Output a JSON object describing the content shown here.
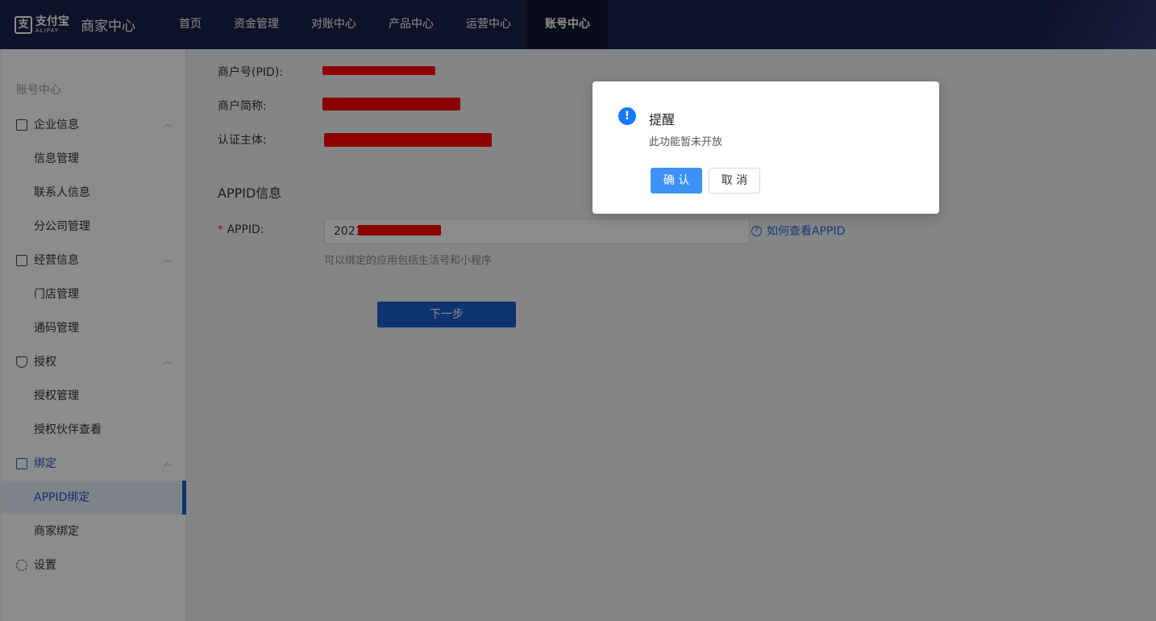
{
  "header": {
    "logo_cn": "支付宝",
    "logo_en": "ALIPAY",
    "title": "商家中心",
    "nav": [
      "首页",
      "资金管理",
      "对账中心",
      "产品中心",
      "运营中心",
      "账号中心"
    ],
    "active_nav": "账号中心",
    "bg_color": "#1b2149"
  },
  "sidebar": {
    "header": "账号中心",
    "groups": [
      {
        "label": "企业信息",
        "icon": "id-card-icon",
        "children": [
          "信息管理",
          "联系人信息",
          "分公司管理"
        ]
      },
      {
        "label": "经营信息",
        "icon": "document-icon",
        "children": [
          "门店管理",
          "通码管理"
        ]
      },
      {
        "label": "授权",
        "icon": "shield-icon",
        "children": [
          "授权管理",
          "授权伙伴查看"
        ]
      },
      {
        "label": "绑定",
        "icon": "binding-icon",
        "children": [
          "APPID绑定",
          "商家绑定"
        ]
      },
      {
        "label": "设置",
        "icon": "gear-icon",
        "children": []
      }
    ],
    "active_item": "APPID绑定",
    "accent_color": "#1d5ccc"
  },
  "main": {
    "fields": [
      {
        "label": "商户号(PID):"
      },
      {
        "label": "商户简称:"
      },
      {
        "label": "认证主体:"
      }
    ],
    "section_title": "APPID信息",
    "appid_required_mark": "*",
    "appid_label": "APPID:",
    "appid_value": "2021",
    "help_link": "如何查看APPID",
    "hint": "可以绑定的应用包括生活号和小程序",
    "next_button": "下一步"
  },
  "modal": {
    "icon": "info-icon",
    "title": "提醒",
    "content": "此功能暂未开放",
    "ok_button": "确 认",
    "cancel_button": "取 消"
  }
}
